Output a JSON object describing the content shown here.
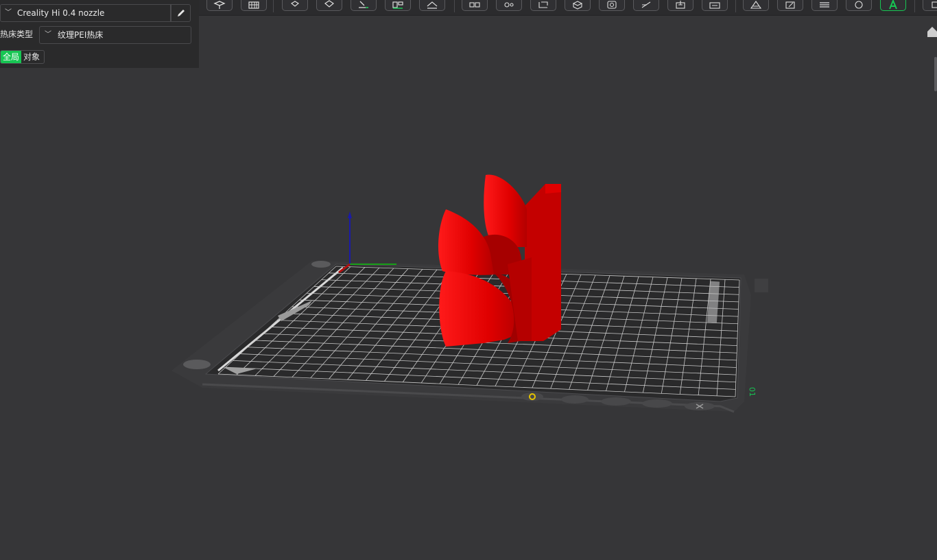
{
  "toolbar": {
    "buttons": [
      "cube-view-icon",
      "grid-icon",
      "add-part-icon",
      "orient-icon",
      "paint-icon",
      "arrange-icon",
      "lay-on-face-icon",
      "split-icon",
      "support-icon",
      "cut-icon",
      "measure-icon",
      "boolean-icon",
      "seam-icon",
      "hollow-icon",
      "text-icon",
      "variable-layer-icon",
      "slice-icon",
      "color-icon",
      "assembly-icon",
      "fuzzy-icon",
      "text-a-icon",
      "layers-icon"
    ]
  },
  "printer": {
    "name": "Creality Hi 0.4 nozzle",
    "edit_icon": "pencil-icon"
  },
  "bed": {
    "label": "热床类型",
    "value": "纹理PEI热床"
  },
  "mode_tabs": {
    "global": "全局",
    "object": "对象"
  },
  "colors": {
    "model": "#e50000",
    "accent": "#17c653",
    "background": "#363638"
  }
}
